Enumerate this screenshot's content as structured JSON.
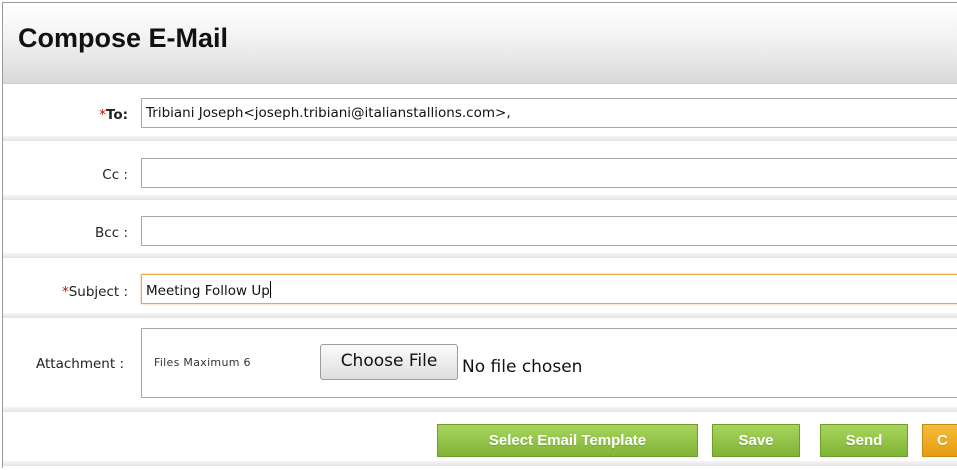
{
  "header": {
    "title": "Compose E-Mail"
  },
  "form": {
    "to": {
      "required_mark": "*",
      "label": "To:",
      "value": "Tribiani Joseph<joseph.tribiani@italianstallions.com>,"
    },
    "cc": {
      "label": "Cc :",
      "value": ""
    },
    "bcc": {
      "label": "Bcc :",
      "value": ""
    },
    "subject": {
      "required_mark": "*",
      "label": "Subject :",
      "value": "Meeting Follow Up"
    },
    "attachment": {
      "label": "Attachment :",
      "hint": "Files Maximum 6",
      "choose_label": "Choose File",
      "status": "No file chosen"
    }
  },
  "actions": {
    "select_template": "Select Email Template",
    "save": "Save",
    "send": "Send",
    "cut_off_button": "C"
  },
  "colors": {
    "required": "#d00000",
    "button_green": "#8bc043",
    "button_orange": "#eea71f",
    "focus_border": "#e3a949"
  }
}
